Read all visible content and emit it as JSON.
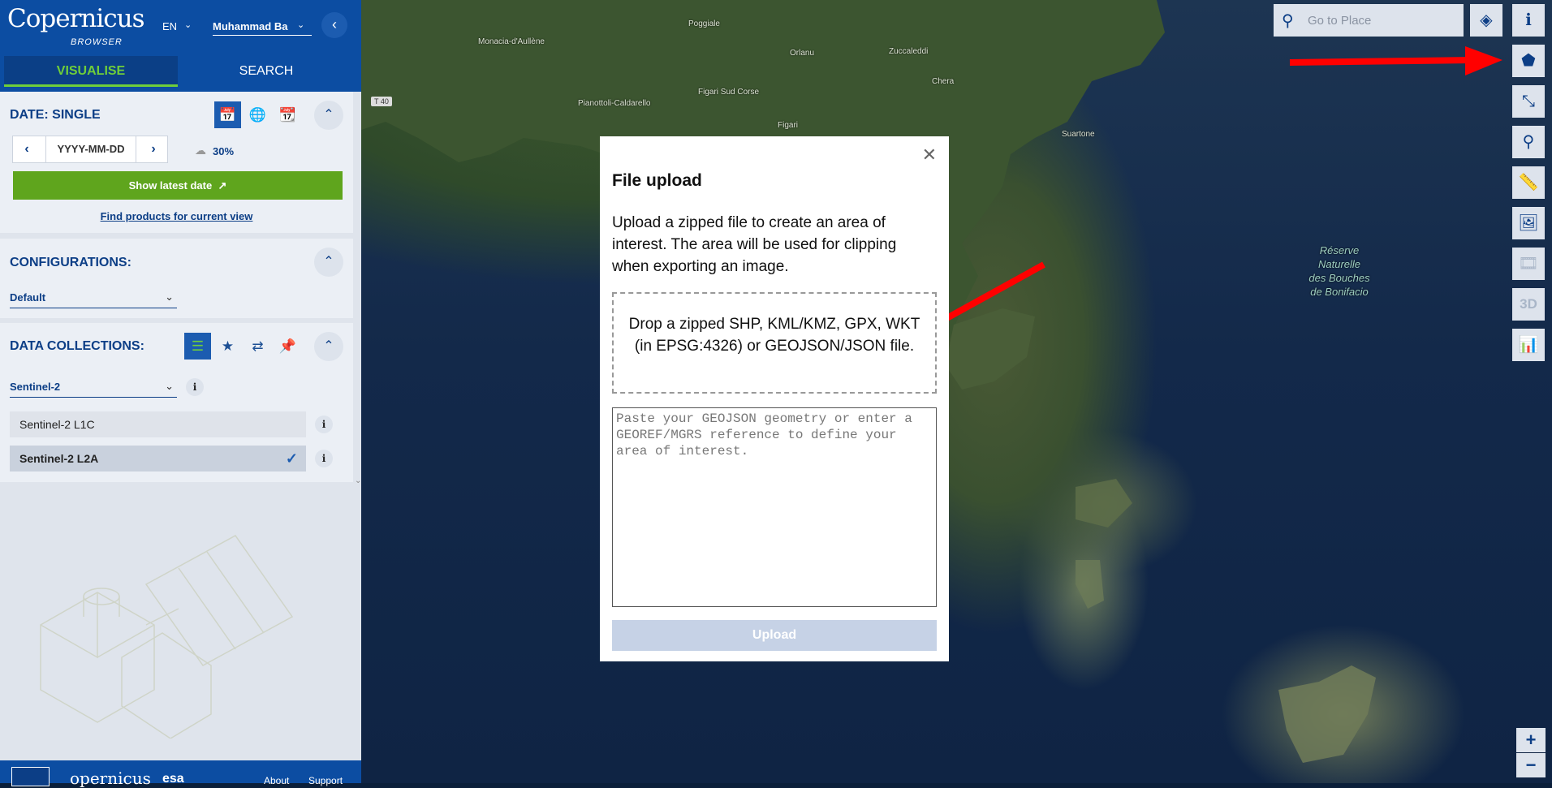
{
  "header": {
    "logo_main": "Copernicus",
    "logo_sub": "BROWSER",
    "language": "EN",
    "user": "Muhammad Ba"
  },
  "tabs": {
    "visualise": "VISUALISE",
    "search": "SEARCH"
  },
  "date_panel": {
    "title": "DATE: SINGLE",
    "date_value": "YYYY-MM-DD",
    "cloud_coverage": "30%",
    "latest_button": "Show latest date",
    "find_products": "Find products for current view"
  },
  "config_panel": {
    "title": "CONFIGURATIONS:",
    "selected": "Default"
  },
  "collections_panel": {
    "title": "DATA COLLECTIONS:",
    "selected": "Sentinel-2",
    "items": [
      {
        "label": "Sentinel-2 L1C",
        "checked": false
      },
      {
        "label": "Sentinel-2 L2A",
        "checked": true
      }
    ]
  },
  "footer": {
    "logo": "opernicus",
    "esa": "esa",
    "about": "About",
    "support": "Support"
  },
  "search": {
    "placeholder": "Go to Place"
  },
  "right_tools": [
    {
      "icon": "info-icon"
    },
    {
      "icon": "polygon-aoi-icon"
    },
    {
      "icon": "line-measure-icon"
    },
    {
      "icon": "poi-pin-icon"
    },
    {
      "icon": "ruler-icon"
    },
    {
      "icon": "image-download-icon"
    },
    {
      "icon": "timelapse-film-icon"
    },
    {
      "icon": "3d-icon",
      "label": "3D"
    },
    {
      "icon": "chart-icon"
    }
  ],
  "map": {
    "labels": [
      "Monacia-d'Aullène",
      "Poggiale",
      "Orlanu",
      "Zuccaleddi",
      "Chera",
      "Pianottoli-Caldarello",
      "Figari",
      "Figari Sud Corse",
      "Suartone"
    ],
    "road": "T 40",
    "reserve": "Réserve\nNaturelle\ndes Bouches\nde Bonifacio"
  },
  "modal": {
    "title": "File upload",
    "description": "Upload a zipped file to create an area of interest. The area will be used for clipping when exporting an image.",
    "dropzone": "Drop a zipped SHP, KML/KMZ, GPX, WKT (in EPSG:4326) or GEOJSON/JSON file.",
    "textarea_placeholder": "Paste your GEOJSON geometry or enter a GEOREF/MGRS reference to define your area of interest.",
    "upload_button": "Upload"
  },
  "colors": {
    "brand_blue": "#0c4da2",
    "accent_green": "#5fa51d",
    "arrow_red": "#ff0000"
  }
}
